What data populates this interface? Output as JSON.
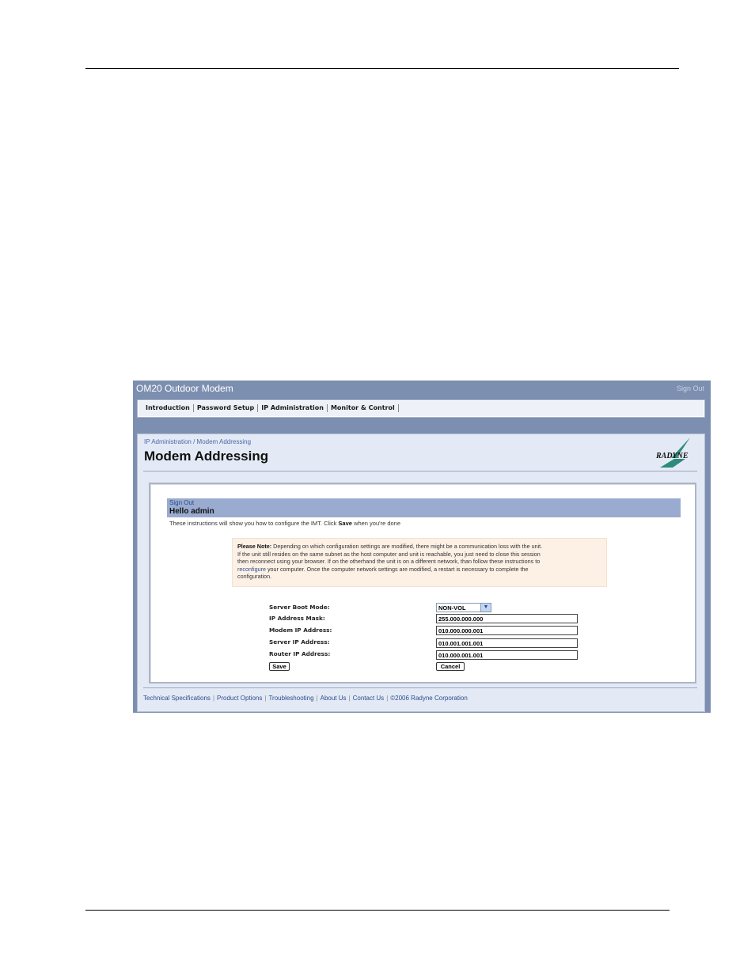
{
  "app": {
    "title": "OM20 Outdoor Modem",
    "sign_out": "Sign Out"
  },
  "nav": {
    "items": [
      "Introduction",
      "Password Setup",
      "IP Administration",
      "Monitor & Control"
    ]
  },
  "page": {
    "breadcrumb": "IP Administration / Modem Addressing",
    "title": "Modem Addressing",
    "logo_text": "RADYNE"
  },
  "greeting": {
    "sign_out": "Sign Out",
    "hello": "Hello admin",
    "instructions_prefix": "These instructions will show you how to configure the IMT. Click ",
    "instructions_bold": "Save",
    "instructions_suffix": " when you're done"
  },
  "note": {
    "heading": "Please Note:",
    "line1": " Depending on which configuration settings are modified, there might be a communication loss with the unit.",
    "line2": "If the unit still resides on the same subnet as the host computer and unit is reachable, you just need to close this session",
    "line3": "then reconnect using your browser. If on the otherhand the unit is on a different network, than follow these instructions to",
    "link": "reconfigure",
    "line4_suffix": " your computer. Once the computer network settings are modified, a restart is necessary to complete the",
    "line5": "configuration."
  },
  "form": {
    "boot_mode_label": "Server Boot Mode:",
    "boot_mode_value": "NON-VOL",
    "ip_mask_label": "IP Address Mask:",
    "ip_mask_value": "255.000.000.000",
    "modem_ip_label": "Modem IP Address:",
    "modem_ip_value": "010.000.000.001",
    "server_ip_label": "Server IP Address:",
    "server_ip_value": "010.001.001.001",
    "router_ip_label": "Router IP Address:",
    "router_ip_value": "010.000.001.001",
    "save_label": "Save",
    "cancel_label": "Cancel"
  },
  "footer": {
    "links": [
      "Technical Specifications",
      "Product Options",
      "Troubleshooting",
      "About Us",
      "Contact Us"
    ],
    "copyright": "©2006 Radyne Corporation"
  }
}
